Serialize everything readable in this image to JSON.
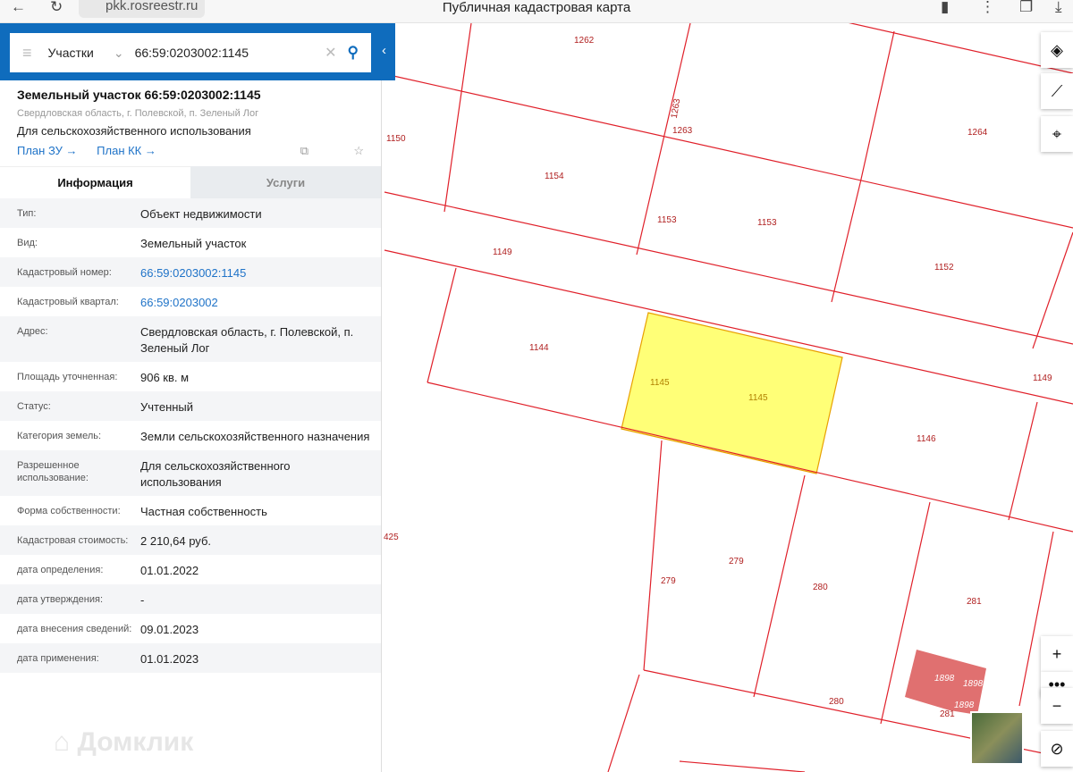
{
  "browser": {
    "url": "pkk.rosreestr.ru",
    "title": "Публичная кадастровая карта"
  },
  "search": {
    "category": "Участки",
    "query": "66:59:0203002:1145"
  },
  "parcel": {
    "title": "Земельный участок 66:59:0203002:1145",
    "address": "Свердловская область, г. Полевской, п. Зеленый Лог",
    "use": "Для сельскохозяйственного использования",
    "link_plan_zu": "План ЗУ →",
    "link_plan_kk": "План КК →"
  },
  "tabs": [
    {
      "label": "Информация"
    },
    {
      "label": "Услуги"
    }
  ],
  "info": [
    {
      "k": "Тип:",
      "v": "Объект недвижимости"
    },
    {
      "k": "Вид:",
      "v": "Земельный участок"
    },
    {
      "k": "Кадастровый номер:",
      "v": "66:59:0203002:1145"
    },
    {
      "k": "Кадастровый квартал:",
      "v": "66:59:0203002"
    },
    {
      "k": "Адрес:",
      "v": "Свердловская область, г. Полевской, п. Зеленый Лог"
    },
    {
      "k": "Площадь уточненная:",
      "v": "906 кв. м"
    },
    {
      "k": "Статус:",
      "v": "Учтенный"
    },
    {
      "k": "Категория земель:",
      "v": "Земли сельскохозяйственного назначения"
    },
    {
      "k": "Разрешенное использование:",
      "v": "Для сельскохозяйственного использования"
    },
    {
      "k": "Форма собственности:",
      "v": "Частная собственность"
    },
    {
      "k": "Кадастровая стоимость:",
      "v": "2 210,64 руб."
    },
    {
      "k": "дата определения:",
      "v": "01.01.2022"
    },
    {
      "k": "дата утверждения:",
      "v": "-"
    },
    {
      "k": "дата внесения сведений:",
      "v": "09.01.2023"
    },
    {
      "k": "дата применения:",
      "v": "01.01.2023"
    }
  ],
  "watermark": "Домклик",
  "map_labels": [
    "1262",
    "1263",
    "1263",
    "1150",
    "1154",
    "1264",
    "1153",
    "1153",
    "1149",
    "1152",
    "1144",
    "1145",
    "1145",
    "1149",
    "1146",
    "425",
    "279",
    "279",
    "280",
    "281",
    "1898",
    "1898",
    "1898",
    "280",
    "281"
  ],
  "colors": {
    "brand": "#0f6cbd",
    "parcel_line": "#e0202a",
    "selected_fill": "#ffff77"
  }
}
